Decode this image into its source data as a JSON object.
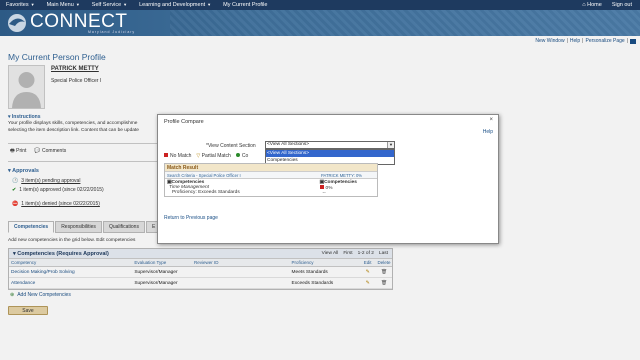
{
  "topnav": {
    "items": [
      "Favorites",
      "Main Menu",
      "Self Service",
      "Learning and Development",
      "My Current Profile"
    ],
    "right": [
      "Home",
      "Sign out"
    ]
  },
  "banner": {
    "logo": "CONNECT",
    "sub": "Maryland Judiciary"
  },
  "util": {
    "links": [
      "New Window",
      "Help",
      "Personalize Page"
    ]
  },
  "page": {
    "title": "My Current Person Profile",
    "name": "PATRICK METTY",
    "job": "Special Police Officer I"
  },
  "instructions": {
    "head": "Instructions",
    "line1": "Your profile displays skills, competencies, and accomplishme",
    "line2": "selecting the item description link. Content that can be update"
  },
  "print": {
    "print": "Print",
    "comments": "Comments"
  },
  "approvals": {
    "head": "Approvals",
    "pending": "3 item(s) pending approval",
    "approved": "1 item(s) approved (since 02/22/2015)",
    "denied": "1 item(s) denied (since 02/22/2015)"
  },
  "tabs": [
    "Competencies",
    "Responsibilities",
    "Qualifications",
    "E"
  ],
  "hint": "Add new competencies in the grid below. Edit competencies",
  "grid": {
    "title": "Competencies (Requires Approval)",
    "nav": {
      "viewall": "View All",
      "first": "First",
      "range": "1-2 of 2",
      "last": "Last"
    },
    "columns": [
      "Competency",
      "Evaluation Type",
      "Reviewer ID",
      "Proficiency",
      "Edit",
      "Delete"
    ],
    "rows": [
      {
        "competency": "Decision Making/Prob Solving",
        "eval": "Supervisor/Manager",
        "reviewer": "",
        "proficiency": "Meets Standards"
      },
      {
        "competency": "Attendance",
        "eval": "Supervisor/Manager",
        "reviewer": "",
        "proficiency": "Exceeds Standards"
      }
    ]
  },
  "add_comp": "Add New Competencies",
  "save": "Save",
  "modal": {
    "title": "Profile Compare",
    "help": "Help",
    "vcs_label": "*View Content Section",
    "select_value": "<View All Sections>",
    "options": [
      "<View All Sections>",
      "Competencies"
    ],
    "legend": {
      "no_match": "No Match",
      "partial": "Partial Match",
      "co": "Co"
    },
    "match": {
      "head": "Match Result",
      "colA": "Search Criteria - Special Police Officer I",
      "colB": "PATRICK METTY: 0%",
      "left_title": "Competencies",
      "left_item": "Time Management",
      "left_prof": "Proficiency: Exceeds Standards",
      "right_title": "Competencies",
      "right_pct": "0%",
      "right_dash": "--"
    },
    "return": "Return to Previous page"
  },
  "colors": {
    "nav": "#1e3a5f",
    "link": "#1a4f86",
    "accent": "#336699"
  }
}
